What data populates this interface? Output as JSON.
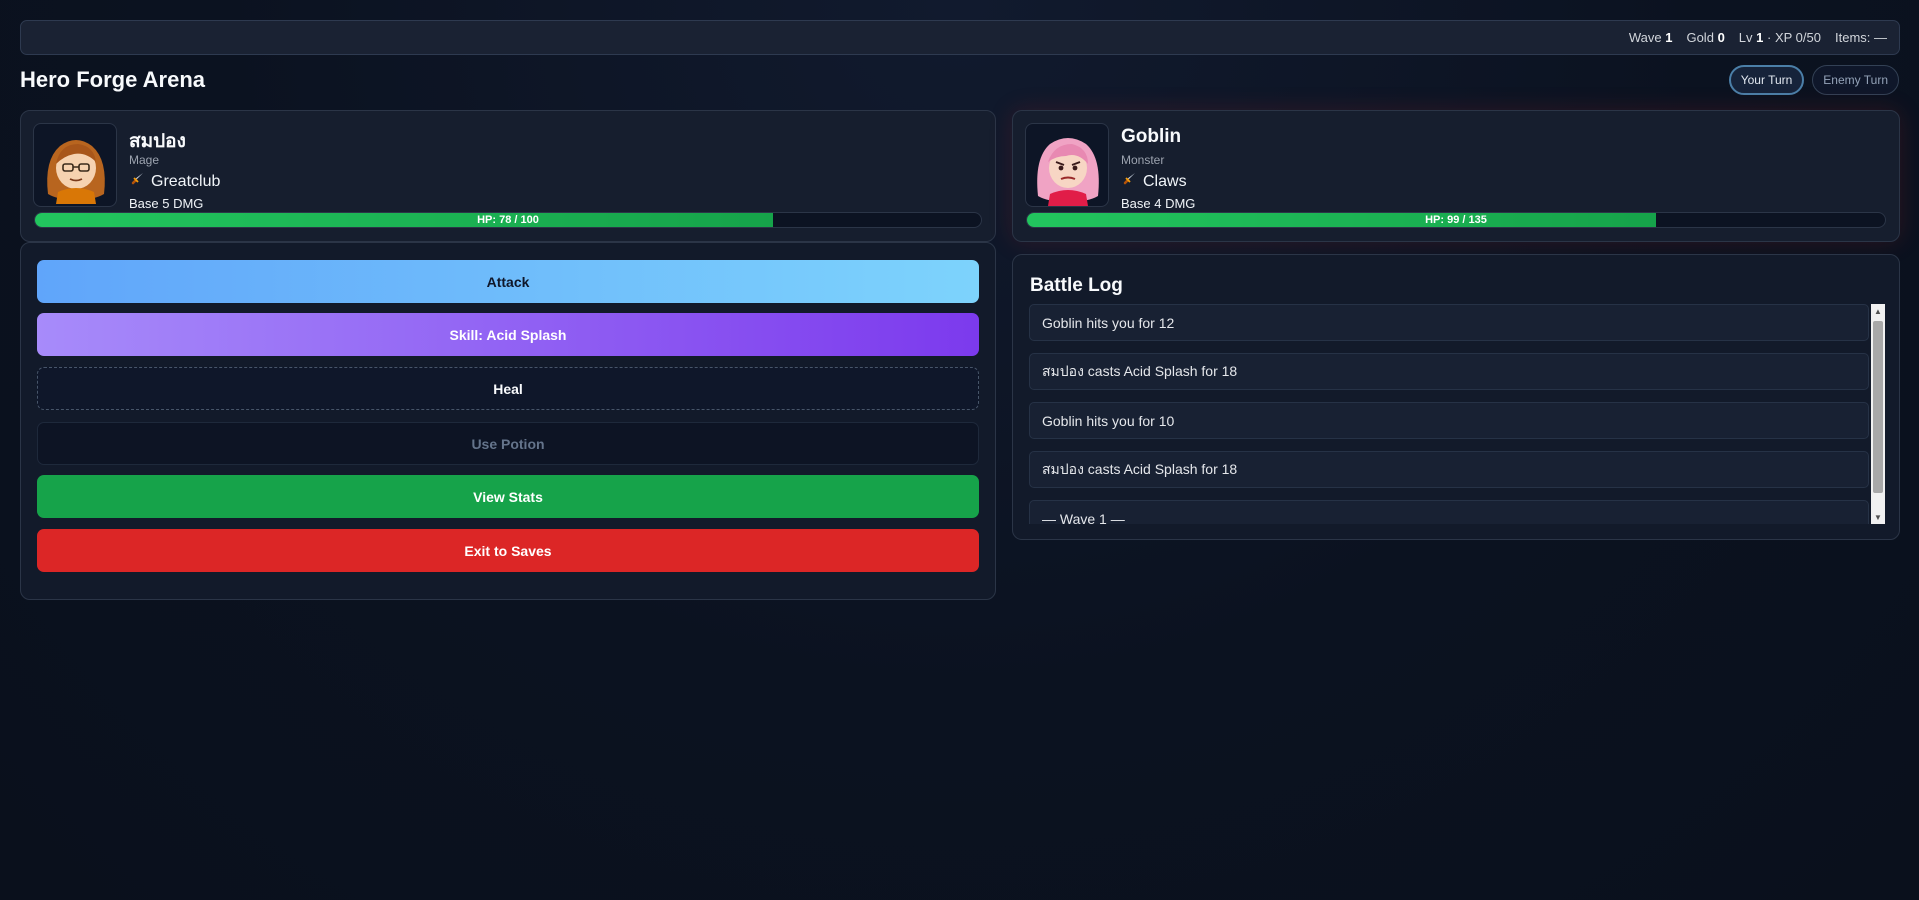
{
  "status": {
    "wave_label": "Wave",
    "wave": "1",
    "gold_label": "Gold",
    "gold": "0",
    "level_label": "Lv",
    "level": "1",
    "xp_text": "· XP 0/50",
    "items_text": "Items: —"
  },
  "app_title": "Hero Forge Arena",
  "turns": {
    "your_turn": "Your Turn",
    "enemy_turn": "Enemy Turn",
    "active": "your_turn"
  },
  "player": {
    "name": "สมปอง",
    "class": "Mage",
    "weapon_icon": "dagger-icon",
    "weapon": "Greatclub",
    "base_damage": "Base 5 DMG",
    "hp_text": "HP: 78 / 100",
    "hp_fraction": 0.78
  },
  "enemy": {
    "name": "Goblin",
    "class": "Monster",
    "weapon_icon": "dagger-icon",
    "weapon": "Claws",
    "base_damage": "Base 4 DMG",
    "hp_text": "HP: 99 / 135",
    "hp_fraction": 0.7333
  },
  "actions": {
    "attack": "Attack",
    "skill": "Skill: Acid Splash",
    "heal": "Heal",
    "potion": "Use Potion",
    "stats": "View Stats",
    "exit": "Exit to Saves"
  },
  "colors": {
    "hp_green": "#22c55e",
    "attack_blue": "#60a5fa",
    "skill_purple": "#7c3aed",
    "stats_green": "#16a34a",
    "exit_red": "#dc2626"
  },
  "battle_log": {
    "title": "Battle Log",
    "entries": [
      "Goblin hits you for 12",
      "สมปอง casts Acid Splash for 18",
      "Goblin hits you for 10",
      "สมปอง casts Acid Splash for 18",
      "— Wave 1 —"
    ]
  }
}
